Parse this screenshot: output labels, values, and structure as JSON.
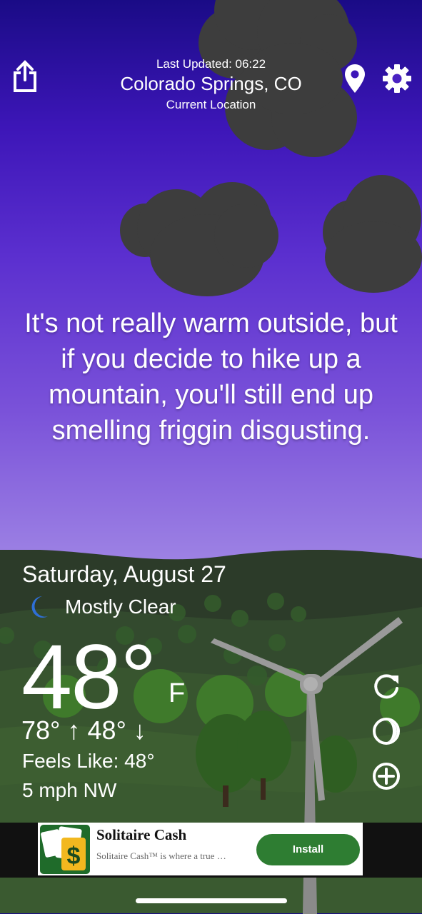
{
  "header": {
    "last_updated": "Last Updated: 06:22",
    "city": "Colorado Springs, CO",
    "location_note": "Current Location"
  },
  "quote": "It's not really warm outside, but if you decide to hike up a mountain, you'll still end up smelling friggin disgusting.",
  "weather": {
    "date": "Saturday, August 27",
    "condition": "Mostly Clear",
    "temperature": "48°",
    "unit": "F",
    "hi_lo": "78° ↑ 48° ↓",
    "feels_like": "Feels Like: 48°",
    "wind": "5 mph NW"
  },
  "ad": {
    "title": "Solitaire Cash",
    "subtitle": "Solitaire Cash™ is where a true …",
    "cta": "Install"
  },
  "icons": {
    "share": "share-icon",
    "location": "location-pin-icon",
    "settings": "gear-icon",
    "condition": "crescent-moon-icon",
    "refresh": "refresh-icon",
    "theme": "theme-icon",
    "add": "add-icon"
  },
  "colors": {
    "sky_top": "#1a0b86",
    "sky_bottom": "#cbb6ee",
    "hills": "#2e3d2a",
    "install_button": "#2e7d32"
  }
}
